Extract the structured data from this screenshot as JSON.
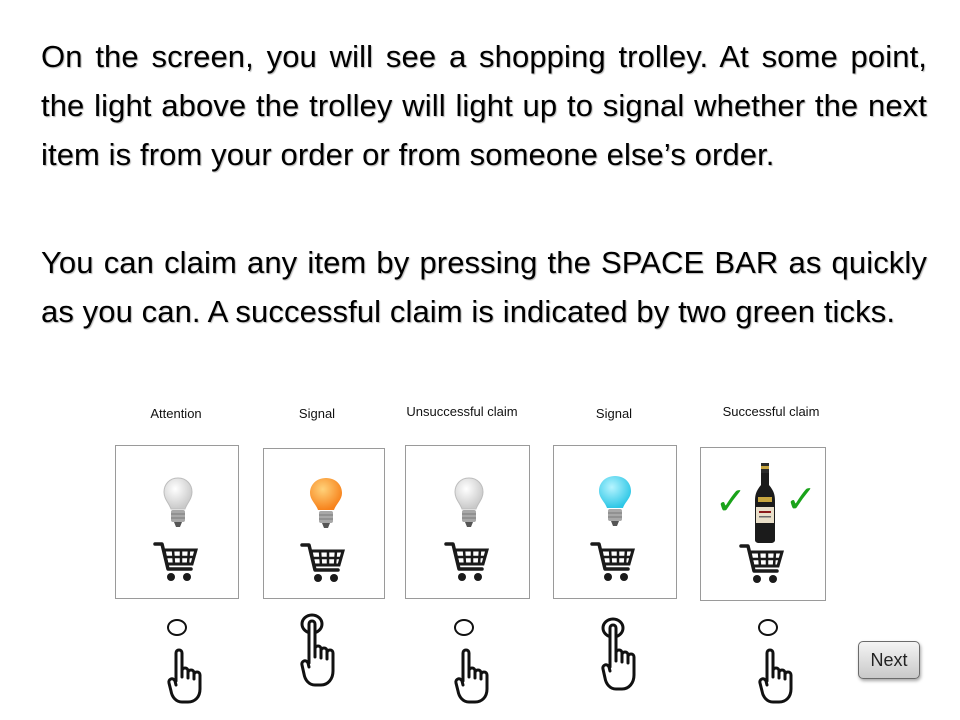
{
  "instructions": {
    "paragraph_1": "On the screen, you will see a shopping trolley. At some point, the light above the trolley will light up to signal whether the next item is from your order or from someone else’s order.",
    "paragraph_2": "You can claim any item by pressing the SPACE BAR as quickly as you can. A successful claim is indicated by two green ticks."
  },
  "stages": [
    {
      "caption": "Attention",
      "bulb": "white-bulb-icon",
      "hand": "hand-raised-icon"
    },
    {
      "caption": "Signal",
      "bulb": "orange-bulb-icon",
      "hand": "hand-pressing-icon"
    },
    {
      "caption": "Unsuccessful claim",
      "bulb": "white-bulb-icon",
      "hand": "hand-raised-icon"
    },
    {
      "caption": "Signal",
      "bulb": "blue-bulb-icon",
      "hand": "hand-pressing-icon"
    },
    {
      "caption": "Successful  claim",
      "bulb": "bottle-with-ticks",
      "hand": "hand-raised-icon"
    }
  ],
  "tick_glyph": "✓",
  "colors": {
    "orange_bulb": "#f7821b",
    "blue_bulb": "#2ec7e6",
    "white_bulb": "#e8e8e8",
    "tick": "#1aa31a"
  },
  "next_button": {
    "label": "Next"
  }
}
